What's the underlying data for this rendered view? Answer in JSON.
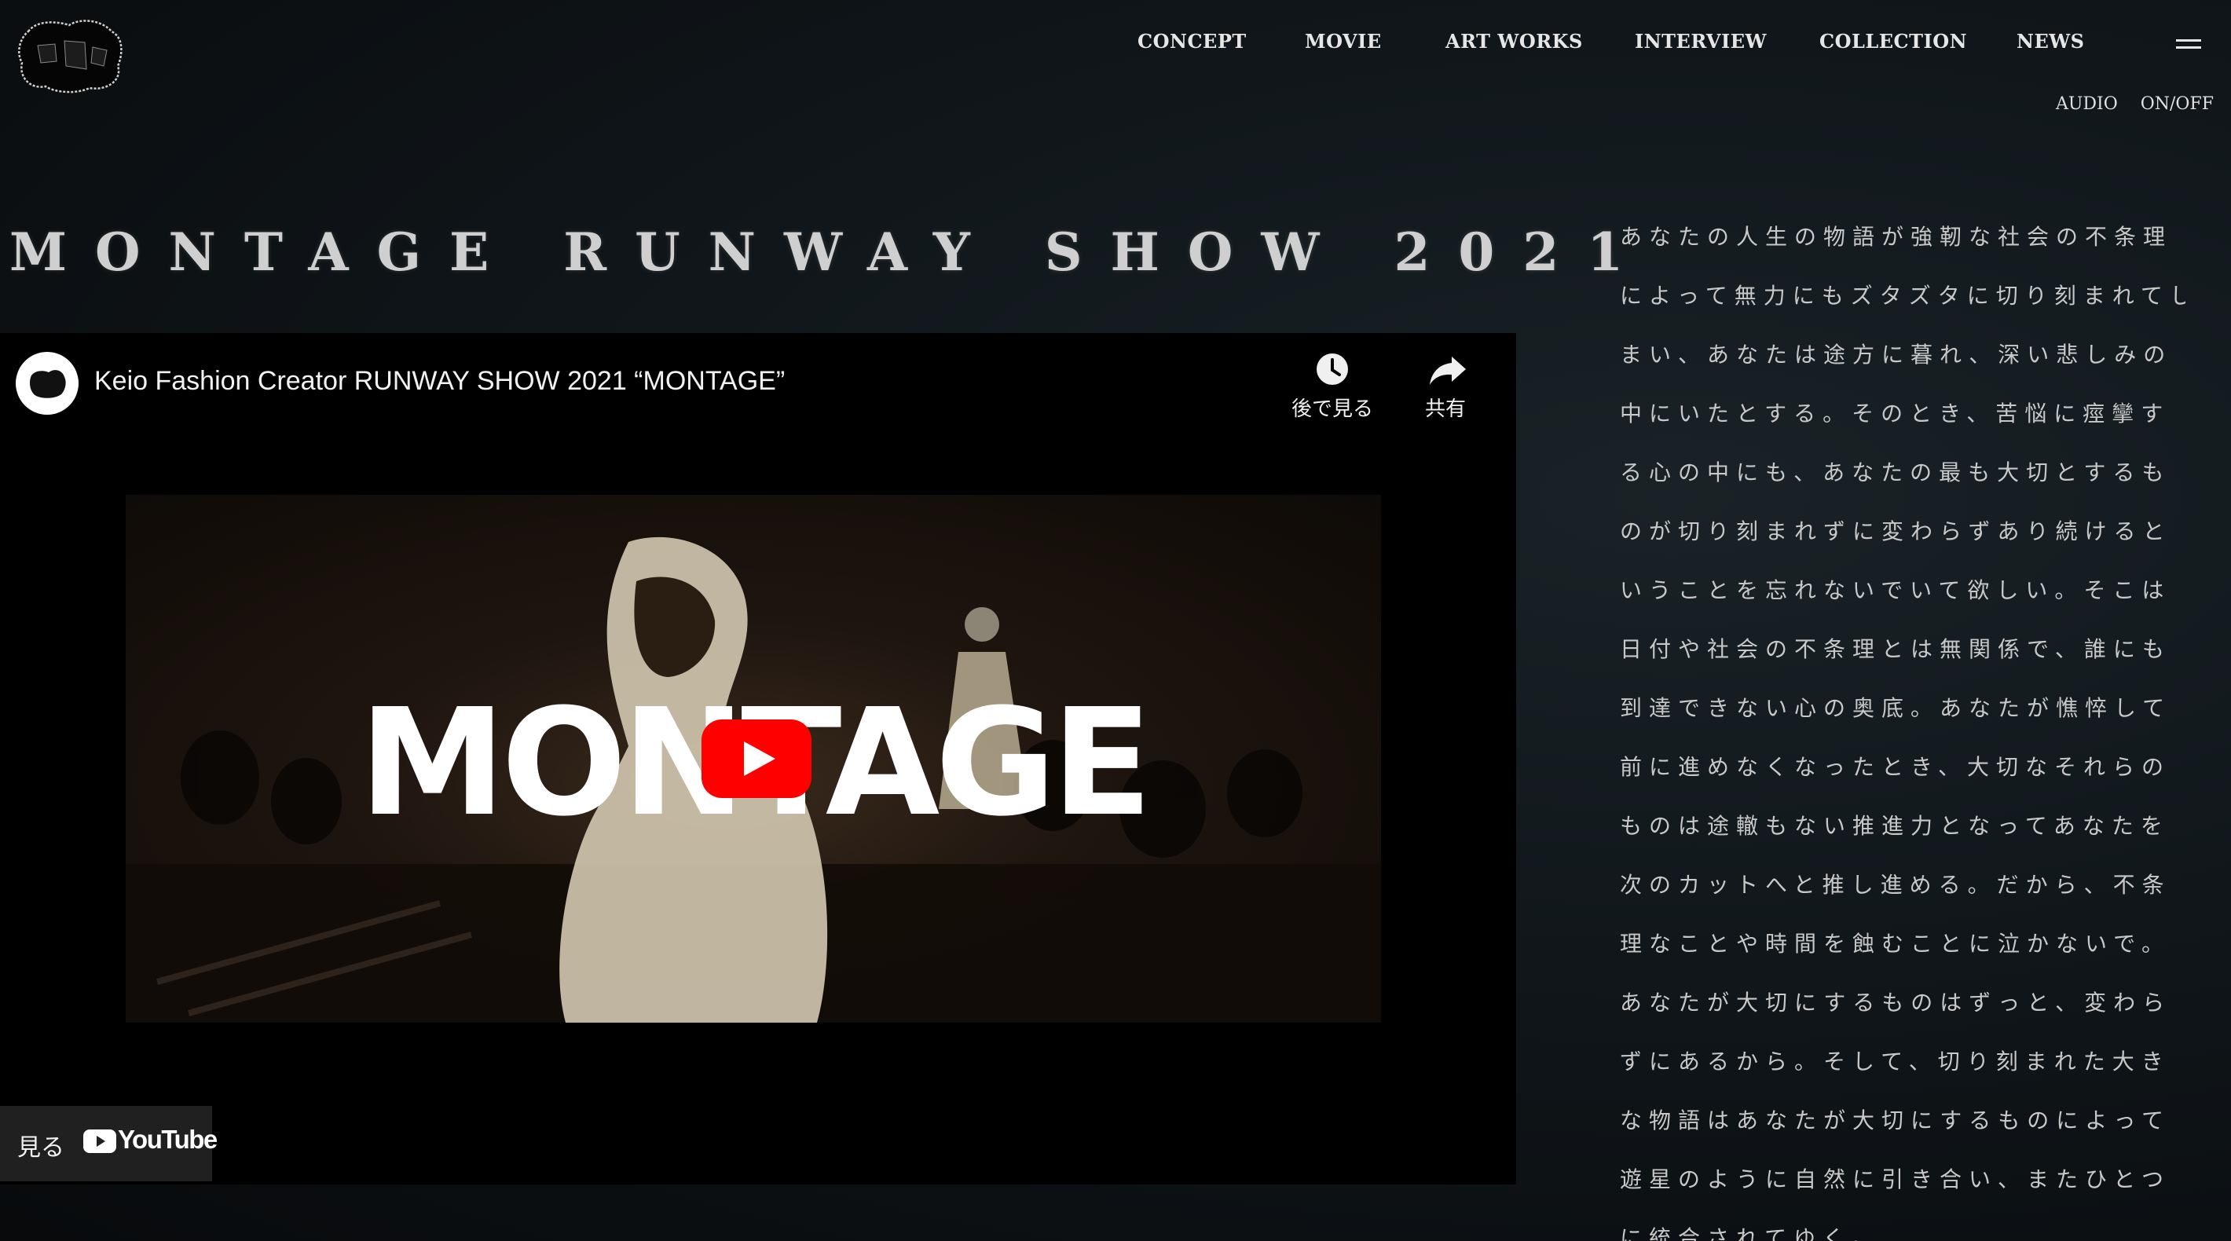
{
  "nav": {
    "items": [
      {
        "label": "CONCEPT"
      },
      {
        "label": "MOVIE"
      },
      {
        "label": "ART WORKS"
      },
      {
        "label": "INTERVIEW"
      },
      {
        "label": "COLLECTION"
      },
      {
        "label": "NEWS"
      }
    ],
    "menu_icon": "hamburger-icon"
  },
  "audio": {
    "label": "AUDIO",
    "toggle": "ON/OFF"
  },
  "page_title": "MONTAGE RUNWAY SHOW 2021",
  "video": {
    "title": "Keio Fashion Creator RUNWAY SHOW 2021 “MONTAGE”",
    "watch_later_label": "後で見る",
    "share_label": "共有",
    "thumbnail_text": "MONTAGE",
    "watch_on_label": "見る",
    "youtube_word": "YouTube",
    "play_color": "#ff0000",
    "icons": [
      "clock-icon",
      "share-arrow-icon",
      "play-icon",
      "youtube-logo-icon"
    ]
  },
  "concept": {
    "lines": [
      "あなたの人生の物語が強靭な社会の不条理",
      "によって無力にもズタズタに切り刻まれてし",
      "まい、あなたは途方に暮れ、深い悲しみの",
      "中にいたとする。そのとき、苦悩に痙攣す",
      "る心の中にも、あなたの最も大切とするも",
      "のが切り刻まれずに変わらずあり続けると",
      "いうことを忘れないでいて欲しい。そこは",
      "日付や社会の不条理とは無関係で、誰にも",
      "到達できない心の奥底。あなたが憔悴して",
      "前に進めなくなったとき、大切なそれらの",
      "ものは途轍もない推進力となってあなたを",
      "次のカットへと推し進める。だから、不条",
      "理なことや時間を蝕むことに泣かないで。",
      "あなたが大切にするものはずっと、変わら",
      "ずにあるから。そして、切り刻まれた大き",
      "な物語はあなたが大切にするものによって",
      "遊星のように自然に引き合い、またひとつ",
      "に統合されてゆく。"
    ]
  },
  "colors": {
    "background": "#0c1014",
    "text": "#d8d8d8",
    "player_bg": "#000000",
    "youtube_red": "#ff0000"
  }
}
